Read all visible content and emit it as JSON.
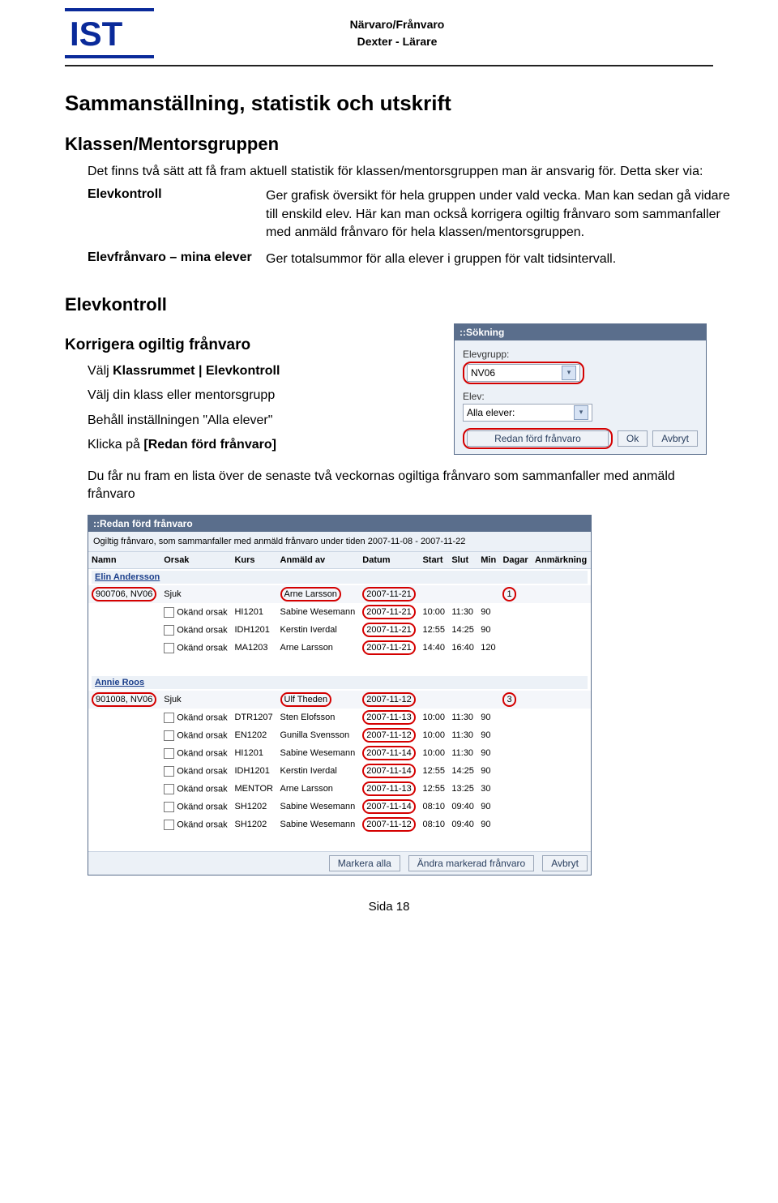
{
  "header": {
    "logo_text": "IST",
    "title1": "Närvaro/Frånvaro",
    "title2": "Dexter - Lärare"
  },
  "h1": "Sammanställning, statistik och utskrift",
  "h2_klassen": "Klassen/Mentorsgruppen",
  "intro": "Det finns två sätt att få fram aktuell statistik för klassen/mentorsgruppen man är ansvarig för. Detta sker via:",
  "def": {
    "elevkontroll_label": "Elevkontroll",
    "elevkontroll_desc": "Ger grafisk översikt för hela gruppen under vald vecka. Man kan sedan gå vidare till enskild elev. Här kan man också korrigera ogiltig frånvaro som sammanfaller med anmäld frånvaro för hela klassen/mentorsgruppen.",
    "elevfran_label": "Elevfrånvaro – mina elever",
    "elevfran_desc": "Ger totalsummor för alla elever i gruppen för valt tidsintervall."
  },
  "h2_elevkontroll": "Elevkontroll",
  "h3_korr": "Korrigera ogiltig frånvaro",
  "steps": {
    "s1_pre": "Välj ",
    "s1_b": "Klassrummet | Elevkontroll",
    "s2": "Välj din klass eller mentorsgrupp",
    "s3": "Behåll inställningen \"Alla elever\"",
    "s4_pre": "Klicka på ",
    "s4_b": "[Redan förd frånvaro]",
    "s5": "Du får nu fram en lista över de senaste två veckornas ogiltiga frånvaro som sammanfaller med anmäld frånvaro"
  },
  "sok_panel": {
    "title": "::Sökning",
    "elevgrupp_label": "Elevgrupp:",
    "elevgrupp_value": "NV06",
    "elev_label": "Elev:",
    "elev_value": "Alla elever:",
    "btn_redan": "Redan förd frånvaro",
    "btn_ok": "Ok",
    "btn_avbryt": "Avbryt"
  },
  "red_panel": {
    "title": "::Redan förd frånvaro",
    "note": "Ogiltig frånvaro, som sammanfaller med anmäld frånvaro under tiden 2007-11-08 - 2007-11-22",
    "cols": [
      "Namn",
      "Orsak",
      "Kurs",
      "Anmäld av",
      "Datum",
      "Start",
      "Slut",
      "Min",
      "Dagar",
      "Anmärkning"
    ],
    "students": [
      {
        "name": "Elin Andersson",
        "id_row": {
          "id": "900706, NV06",
          "orsak": "Sjuk",
          "anmald_av": "Arne Larsson",
          "datum": "2007-11-21",
          "dagar": "1"
        },
        "rows": [
          {
            "orsak": "Okänd orsak",
            "kurs": "HI1201",
            "anmald_av": "Sabine Wesemann",
            "datum": "2007-11-21",
            "start": "10:00",
            "slut": "11:30",
            "min": "90"
          },
          {
            "orsak": "Okänd orsak",
            "kurs": "IDH1201",
            "anmald_av": "Kerstin Iverdal",
            "datum": "2007-11-21",
            "start": "12:55",
            "slut": "14:25",
            "min": "90"
          },
          {
            "orsak": "Okänd orsak",
            "kurs": "MA1203",
            "anmald_av": "Arne Larsson",
            "datum": "2007-11-21",
            "start": "14:40",
            "slut": "16:40",
            "min": "120"
          }
        ]
      },
      {
        "name": "Annie Roos",
        "id_row": {
          "id": "901008, NV06",
          "orsak": "Sjuk",
          "anmald_av": "Ulf Theden",
          "datum": "2007-11-12",
          "dagar": "3"
        },
        "rows": [
          {
            "orsak": "Okänd orsak",
            "kurs": "DTR1207",
            "anmald_av": "Sten Elofsson",
            "datum": "2007-11-13",
            "start": "10:00",
            "slut": "11:30",
            "min": "90"
          },
          {
            "orsak": "Okänd orsak",
            "kurs": "EN1202",
            "anmald_av": "Gunilla Svensson",
            "datum": "2007-11-12",
            "start": "10:00",
            "slut": "11:30",
            "min": "90"
          },
          {
            "orsak": "Okänd orsak",
            "kurs": "HI1201",
            "anmald_av": "Sabine Wesemann",
            "datum": "2007-11-14",
            "start": "10:00",
            "slut": "11:30",
            "min": "90"
          },
          {
            "orsak": "Okänd orsak",
            "kurs": "IDH1201",
            "anmald_av": "Kerstin Iverdal",
            "datum": "2007-11-14",
            "start": "12:55",
            "slut": "14:25",
            "min": "90"
          },
          {
            "orsak": "Okänd orsak",
            "kurs": "MENTOR",
            "anmald_av": "Arne Larsson",
            "datum": "2007-11-13",
            "start": "12:55",
            "slut": "13:25",
            "min": "30"
          },
          {
            "orsak": "Okänd orsak",
            "kurs": "SH1202",
            "anmald_av": "Sabine Wesemann",
            "datum": "2007-11-14",
            "start": "08:10",
            "slut": "09:40",
            "min": "90"
          },
          {
            "orsak": "Okänd orsak",
            "kurs": "SH1202",
            "anmald_av": "Sabine Wesemann",
            "datum": "2007-11-12",
            "start": "08:10",
            "slut": "09:40",
            "min": "90"
          }
        ]
      }
    ],
    "btn_markera": "Markera alla",
    "btn_andra": "Ändra markerad frånvaro",
    "btn_avbryt": "Avbryt"
  },
  "footer": "Sida 18"
}
